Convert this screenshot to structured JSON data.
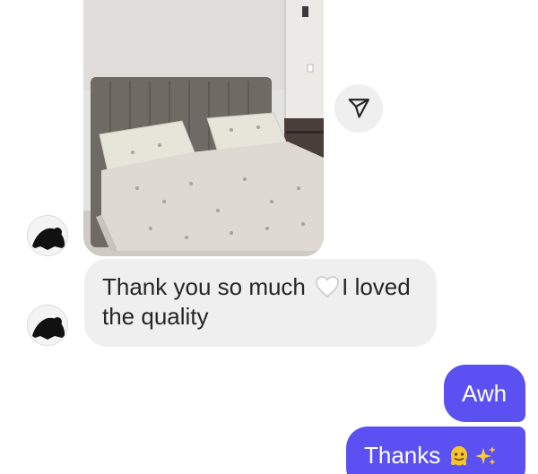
{
  "conversation": {
    "photo": {
      "alt": "bed",
      "share_icon": "paper-plane-icon"
    },
    "messages": [
      {
        "sender": "contact",
        "text_before_emoji": "Thank you so much ",
        "emoji": "white-heart-icon",
        "text_after_emoji": "I loved",
        "text_line2": "the quality"
      },
      {
        "sender": "me",
        "text": "Awh"
      },
      {
        "sender": "me",
        "text": "Thanks ",
        "emojis": [
          "melting-face-icon",
          "sparkles-icon"
        ]
      }
    ]
  },
  "colors": {
    "outgoing_bubble": "#5b51f2",
    "incoming_bubble": "#efefef",
    "incoming_text": "#262626",
    "outgoing_text": "#ffffff"
  }
}
